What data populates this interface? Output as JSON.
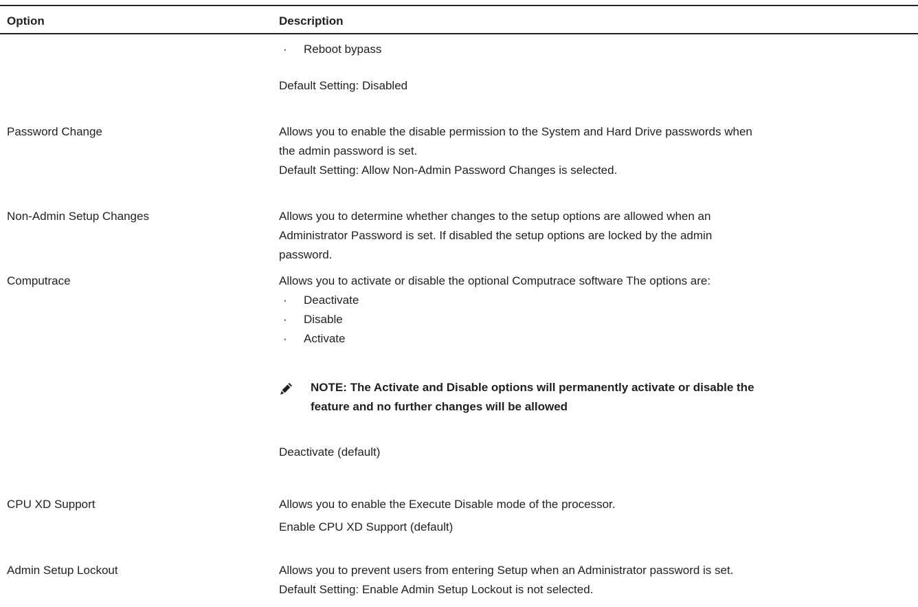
{
  "table": {
    "header": {
      "option": "Option",
      "description": "Description"
    },
    "rows": {
      "r0": {
        "option": "",
        "bullets": [
          "Reboot bypass"
        ],
        "default": "Default Setting: Disabled"
      },
      "r1": {
        "option": "Password Change",
        "desc_lines": [
          "Allows you to enable the disable permission to the System and Hard Drive passwords when",
          "the admin password is set."
        ],
        "default": "Default Setting: Allow Non-Admin Password Changes is selected."
      },
      "r2": {
        "option": "Non-Admin Setup Changes",
        "desc_lines": [
          "Allows you to determine whether changes to the setup options are allowed when an",
          "Administrator Password is set. If disabled the setup options are locked by the admin",
          "password."
        ]
      },
      "r3": {
        "option": "Computrace",
        "desc_lines": [
          "Allows you to activate or disable the optional Computrace software The options are:"
        ],
        "bullets": [
          "Deactivate",
          "Disable",
          "Activate"
        ],
        "note_lines": [
          "NOTE: The Activate and Disable options will permanently activate or disable the",
          "feature and no further changes will be allowed"
        ],
        "note_icon": "pencil-note-icon",
        "default": "Deactivate (default)"
      },
      "r4": {
        "option": "CPU XD Support",
        "desc_lines": [
          "Allows you to enable the Execute Disable mode of the processor."
        ],
        "default": "Enable CPU XD Support (default)"
      },
      "r5": {
        "option": "Admin Setup Lockout",
        "desc_lines": [
          "Allows you to prevent users from entering Setup when an Administrator password is set."
        ],
        "default": "Default Setting: Enable Admin Setup Lockout is not selected."
      }
    },
    "bullet_char": "·"
  },
  "colors": {
    "text": "#231f20",
    "rule": "#231f20",
    "background": "#ffffff"
  }
}
